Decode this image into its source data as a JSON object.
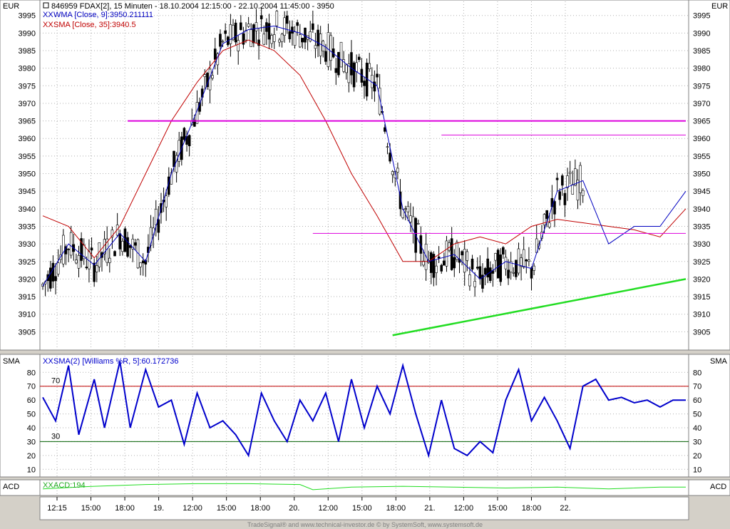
{
  "ui": {
    "currency_label": "EUR",
    "sma_panel_label": "SMA",
    "acd_panel_label": "ACD",
    "title": "846959  FDAX[2], 15 Minuten - 18.10.2004 12:15:00 - 22.10.2004 11:45:00 - 3950",
    "legend_wma": "WMA [Close, 9]:3950.211111",
    "legend_sma": "SMA [Close, 35]:3940.5",
    "legend_williams": "SMA(2) [Williams %R, 5]:60.172736",
    "legend_acd": "ACD:194",
    "footer": "TradeSignal® and www.technical-investor.de © by SystemSoft, www.systemsoft.de",
    "colors": {
      "candle": "#000000",
      "wma": "#0000c0",
      "sma": "#c00000",
      "support_line": "#22dd22",
      "resistance_line": "#dd00dd",
      "williams": "#0000cc",
      "level_70": "#c00000",
      "level_30": "#006000",
      "acd": "#22dd22"
    }
  },
  "chart_data": [
    {
      "type": "candlestick",
      "ylim": [
        3900,
        3999
      ],
      "y_ticks": [
        3905,
        3910,
        3915,
        3920,
        3925,
        3930,
        3935,
        3940,
        3945,
        3950,
        3955,
        3960,
        3965,
        3970,
        3975,
        3980,
        3985,
        3990,
        3995
      ],
      "x_ticks": [
        "12:15",
        "15:00",
        "18:00",
        "19.",
        "12:00",
        "15:00",
        "18:00",
        "20.",
        "12:00",
        "15:00",
        "18:00",
        "21.",
        "12:00",
        "15:00",
        "18:00",
        "22."
      ],
      "series": [
        {
          "name": "WMA [Close, 9]",
          "x": [
            0,
            10,
            20,
            30,
            40,
            50,
            60,
            70,
            80,
            90,
            100,
            110,
            120,
            130,
            140,
            150,
            160,
            170,
            180,
            190,
            200,
            210,
            220,
            230,
            240,
            250
          ],
          "values": [
            3918,
            3930,
            3924,
            3933,
            3925,
            3950,
            3968,
            3987,
            3991,
            3992,
            3990,
            3986,
            3980,
            3975,
            3940,
            3925,
            3927,
            3920,
            3925,
            3923,
            3945,
            3948,
            3930,
            3935,
            3935,
            3945
          ]
        },
        {
          "name": "SMA [Close, 35]",
          "x": [
            0,
            10,
            20,
            30,
            40,
            50,
            60,
            70,
            80,
            90,
            100,
            110,
            120,
            130,
            140,
            150,
            160,
            170,
            180,
            190,
            200,
            210,
            220,
            230,
            240,
            250
          ],
          "values": [
            3938,
            3935,
            3926,
            3935,
            3950,
            3965,
            3976,
            3985,
            3988,
            3985,
            3978,
            3965,
            3950,
            3938,
            3925,
            3925,
            3930,
            3932,
            3930,
            3935,
            3937,
            3936,
            3935,
            3934,
            3932,
            3940
          ]
        }
      ],
      "lines": [
        {
          "name": "support",
          "from": [
            136,
            3904
          ],
          "to": [
            250,
            3920
          ]
        },
        {
          "name": "resistance",
          "from": [
            33,
            3965
          ],
          "to": [
            250,
            3965
          ]
        },
        {
          "name": "resistance",
          "from": [
            155,
            3961
          ],
          "to": [
            250,
            3961
          ]
        },
        {
          "name": "resistance",
          "from": [
            105,
            3933
          ],
          "to": [
            250,
            3933
          ]
        }
      ]
    },
    {
      "type": "line",
      "ylim": [
        5,
        92
      ],
      "y_ticks": [
        10,
        20,
        30,
        40,
        50,
        60,
        70,
        80
      ],
      "levels": [
        {
          "label": "70",
          "value": 70
        },
        {
          "label": "30",
          "value": 30
        }
      ],
      "series": [
        {
          "name": "SMA(2) [Williams %R, 5]",
          "x": [
            0,
            5,
            10,
            14,
            20,
            24,
            30,
            34,
            40,
            45,
            50,
            55,
            60,
            65,
            70,
            75,
            80,
            85,
            90,
            95,
            100,
            105,
            110,
            115,
            120,
            125,
            130,
            135,
            140,
            145,
            150,
            155,
            160,
            165,
            170,
            175,
            180,
            185,
            190,
            195,
            200,
            205,
            210,
            215,
            220,
            225,
            230,
            235,
            240,
            245,
            250
          ],
          "values": [
            62,
            45,
            85,
            35,
            75,
            40,
            88,
            40,
            82,
            55,
            60,
            28,
            65,
            40,
            45,
            35,
            20,
            65,
            45,
            30,
            60,
            45,
            65,
            30,
            75,
            40,
            70,
            50,
            85,
            50,
            20,
            60,
            25,
            20,
            30,
            22,
            60,
            82,
            45,
            62,
            45,
            25,
            70,
            75,
            60,
            62,
            58,
            60,
            55,
            60,
            60
          ]
        }
      ]
    },
    {
      "type": "line",
      "series": [
        {
          "name": "ACD",
          "x": [
            0,
            20,
            40,
            60,
            80,
            100,
            105,
            120,
            140,
            160,
            180,
            200,
            220,
            240,
            250
          ],
          "values": [
            194,
            197,
            199,
            200,
            200,
            199,
            193,
            196,
            197,
            196,
            195,
            196,
            194,
            196,
            196
          ]
        }
      ]
    }
  ]
}
